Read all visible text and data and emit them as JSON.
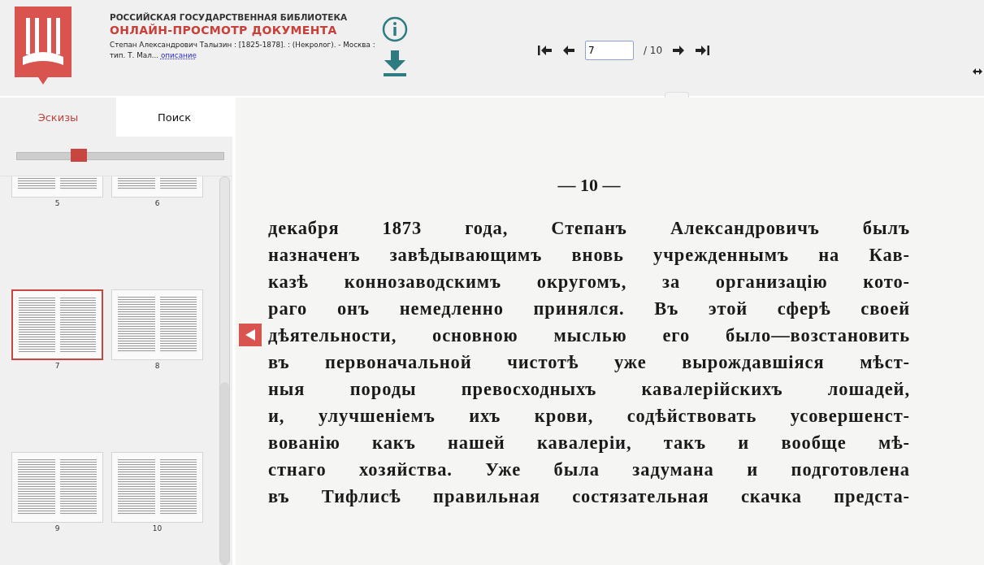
{
  "header": {
    "org_title": "РОССИЙСКАЯ ГОСУДАРСТВЕННАЯ БИБЛИОТЕКА",
    "doc_title": "ОНЛАЙН-ПРОСМОТР ДОКУМЕНТА",
    "description": "Степан Александрович Талызин : [1825-1878]. : (Некролог). - Москва : тип. Т. Мал...",
    "description_link": "описание"
  },
  "navigation": {
    "page_input": "7",
    "total": "/ 10"
  },
  "sidebar": {
    "tabs": [
      {
        "label": "Эскизы",
        "selected": true
      },
      {
        "label": "Поиск",
        "selected": false
      }
    ],
    "zoom_slider": {
      "level": 0.3
    },
    "thumbnails": [
      {
        "label": "5",
        "selected": false
      },
      {
        "label": "6",
        "selected": false
      },
      {
        "label": "7",
        "selected": true
      },
      {
        "label": "8",
        "selected": false
      },
      {
        "label": "9",
        "selected": false
      },
      {
        "label": "10",
        "selected": false
      }
    ]
  },
  "document": {
    "page_number": "— 10 —",
    "lines": [
      "декабря 1873 года, Степанъ Александровичъ былъ",
      "назначенъ завѣдывающимъ вновь учрежденнымъ на Кав-",
      "казѣ коннозаводскимъ округомъ, за организацію кото-",
      "раго онъ немедленно принялся. Въ этой сферѣ своей",
      "дѣятельности, основною мыслью его было—возстановить",
      "въ первоначальной чистотѣ уже вырождавшіяся мѣст-",
      "ныя породы превосходныхъ кавалерійскихъ лошадей,",
      "и, улучшеніемъ ихъ крови, содѣйствовать усовершенст-",
      "вованію какъ нашей кавалеріи, такъ и вообще мѣ-",
      "стнаго хозяйства. Уже была задумана и подготовлена",
      "въ Тифлисѣ правильная состязательная скачка предста-"
    ]
  }
}
